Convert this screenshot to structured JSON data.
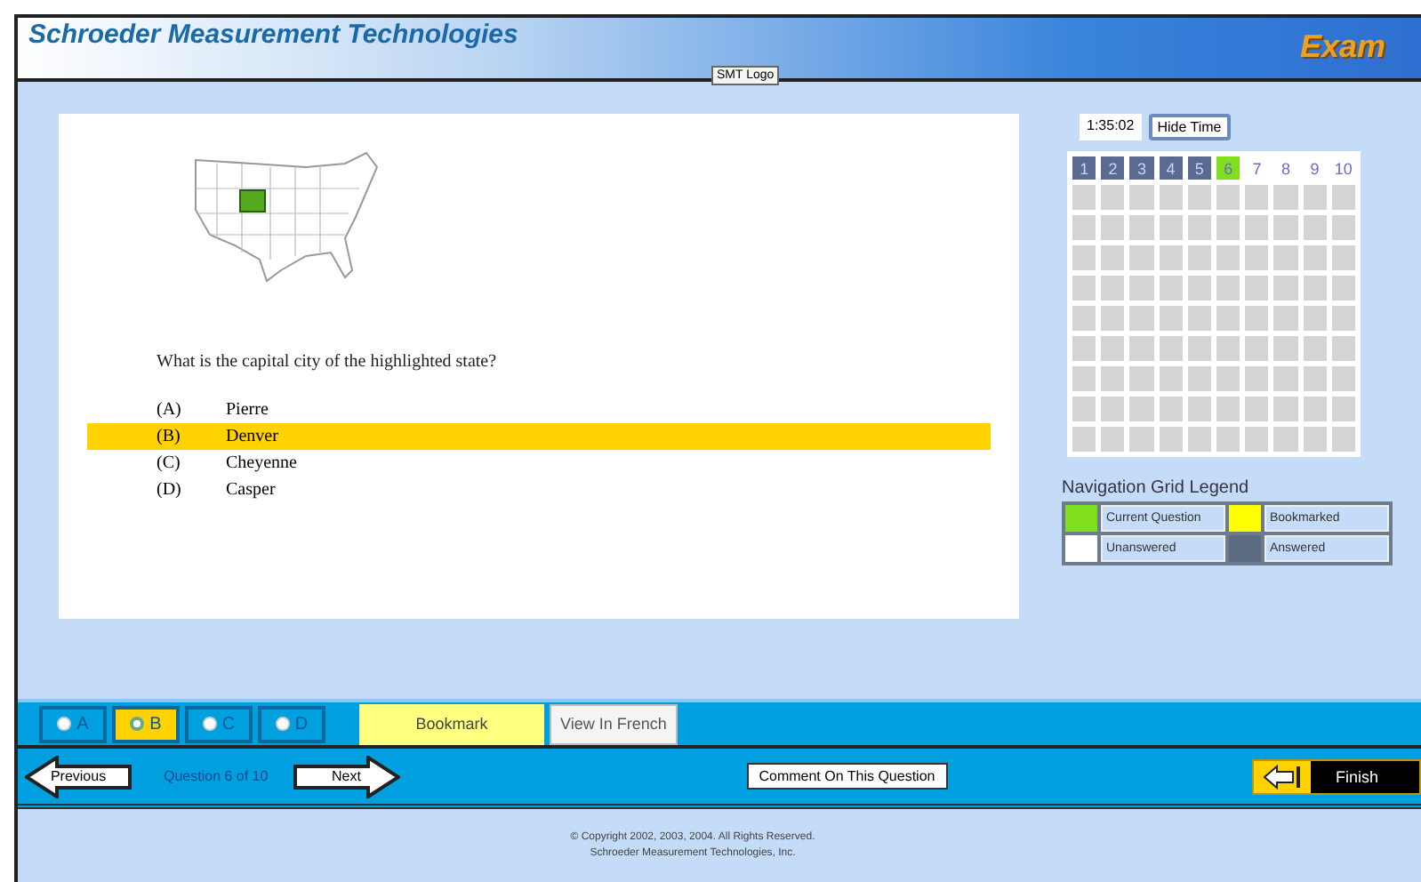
{
  "header": {
    "title": "Schroeder Measurement Technologies",
    "logo_alt": "SMT Logo",
    "badge": "Exam"
  },
  "question": {
    "text": "What is the capital city of the highlighted state?",
    "choices": [
      {
        "letter": "(A)",
        "text": "Pierre",
        "selected": false
      },
      {
        "letter": "(B)",
        "text": "Denver",
        "selected": true
      },
      {
        "letter": "(C)",
        "text": "Cheyenne",
        "selected": false
      },
      {
        "letter": "(D)",
        "text": "Casper",
        "selected": false
      }
    ]
  },
  "timer": {
    "value": "1:35:02",
    "button": "Hide Time"
  },
  "nav_grid": {
    "cells": [
      {
        "label": "1",
        "kind": "answered"
      },
      {
        "label": "2",
        "kind": "answered"
      },
      {
        "label": "3",
        "kind": "answered"
      },
      {
        "label": "4",
        "kind": "answered"
      },
      {
        "label": "5",
        "kind": "answered"
      },
      {
        "label": "6",
        "kind": "current"
      },
      {
        "label": "7",
        "kind": "unanswered"
      },
      {
        "label": "8",
        "kind": "unanswered"
      },
      {
        "label": "9",
        "kind": "unanswered"
      },
      {
        "label": "10",
        "kind": "unanswered"
      }
    ]
  },
  "legend": {
    "title": "Navigation Grid Legend",
    "items": [
      {
        "label": "Current Question",
        "color": "#80e020"
      },
      {
        "label": "Bookmarked",
        "color": "#ffff00"
      },
      {
        "label": "Unanswered",
        "color": "#ffffff"
      },
      {
        "label": "Answered",
        "color": "#5a6a80"
      }
    ]
  },
  "answer_buttons": [
    {
      "label": "A",
      "selected": false
    },
    {
      "label": "B",
      "selected": true
    },
    {
      "label": "C",
      "selected": false
    },
    {
      "label": "D",
      "selected": false
    }
  ],
  "bookmark": "Bookmark",
  "view_french": "View In French",
  "nav": {
    "previous": "Previous",
    "position": "Question 6 of 10",
    "next": "Next",
    "comment": "Comment On This Question",
    "finish": "Finish"
  },
  "footer": [
    "© Copyright 2002, 2003, 2004. All Rights Reserved.",
    "Schroeder Measurement Technologies, Inc."
  ]
}
